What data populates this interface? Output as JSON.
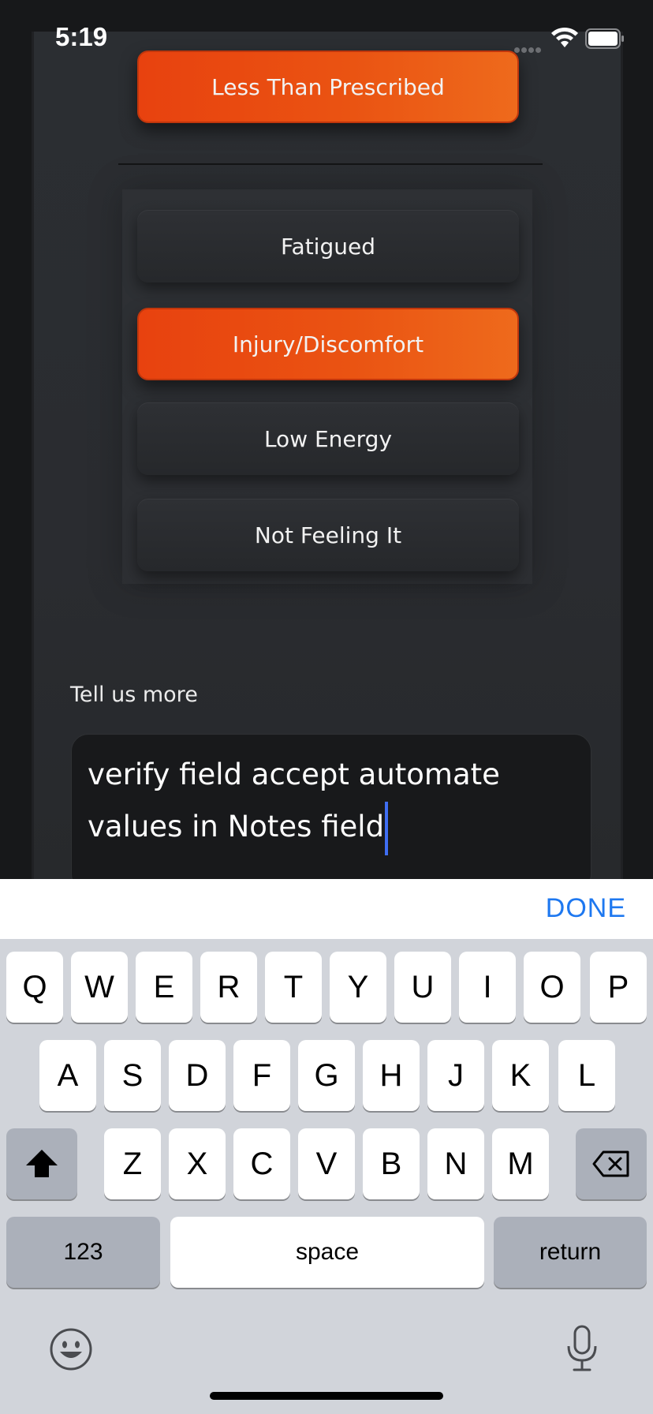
{
  "status_bar": {
    "time": "5:19",
    "icons": [
      "signal-dots-icon",
      "wifi-icon",
      "battery-icon"
    ]
  },
  "reason_buttons": {
    "less_than_prescribed": "Less Than Prescribed",
    "fatigued": "Fatigued",
    "injury_discomfort": "Injury/Discomfort",
    "low_energy": "Low Energy",
    "not_feeling_it": "Not Feeling It"
  },
  "selected": [
    "Less Than Prescribed",
    "Injury/Discomfort"
  ],
  "notes": {
    "label": "Tell us more",
    "value": "verify field accept automate values in Notes field"
  },
  "keyboard": {
    "done_label": "DONE",
    "row1": [
      "Q",
      "W",
      "E",
      "R",
      "T",
      "Y",
      "U",
      "I",
      "O",
      "P"
    ],
    "row2": [
      "A",
      "S",
      "D",
      "F",
      "G",
      "H",
      "J",
      "K",
      "L"
    ],
    "row3": [
      "Z",
      "X",
      "C",
      "V",
      "B",
      "N",
      "M"
    ],
    "numbers_label": "123",
    "space_label": "space",
    "return_label": "return"
  },
  "colors": {
    "accent_orange": "#e8420f",
    "link_blue": "#1e78f0",
    "caret_blue": "#3f6ef2"
  }
}
